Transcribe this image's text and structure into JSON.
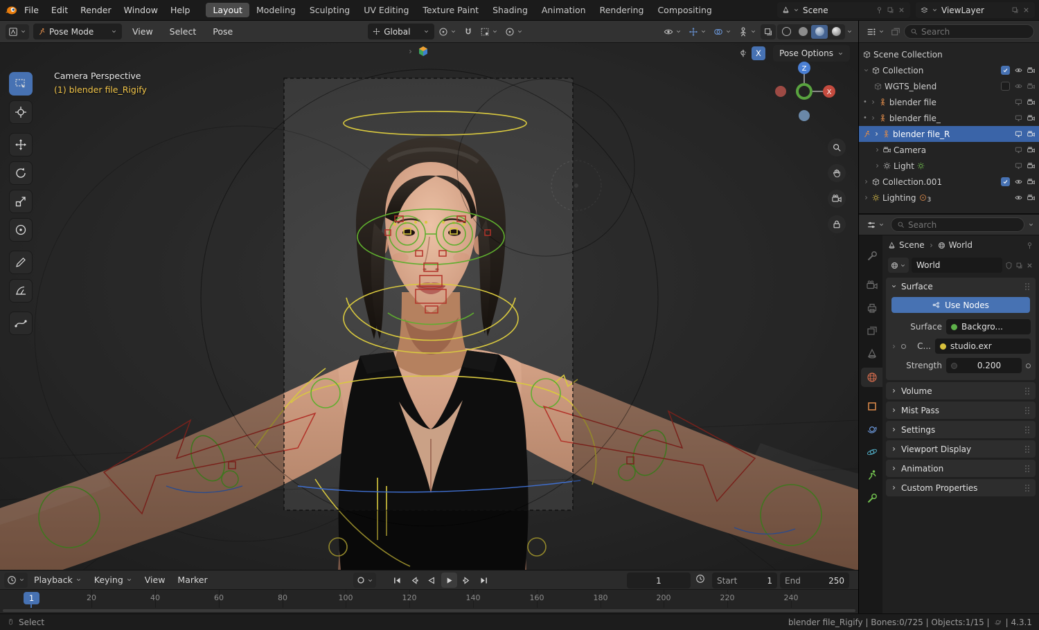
{
  "topbar": {
    "menus": [
      "File",
      "Edit",
      "Render",
      "Window",
      "Help"
    ],
    "workspaces": [
      "Layout",
      "Modeling",
      "Sculpting",
      "UV Editing",
      "Texture Paint",
      "Shading",
      "Animation",
      "Rendering",
      "Compositing"
    ],
    "scene": "Scene",
    "view_layer": "ViewLayer"
  },
  "viewport_header": {
    "mode": "Pose Mode",
    "menu_view": "View",
    "menu_select": "Select",
    "menu_pose": "Pose",
    "orientation": "Global"
  },
  "viewport": {
    "view_label": "Camera Perspective",
    "object_label": "(1) blender file_Rigify",
    "pose_options": "Pose Options",
    "mirror_x": "X",
    "gizmo": {
      "z": "Z",
      "x": "X"
    }
  },
  "outliner": {
    "search_placeholder": "Search",
    "rows": [
      {
        "label": "Scene Collection"
      },
      {
        "label": "Collection"
      },
      {
        "label": "WGTS_blend"
      },
      {
        "label": "blender file"
      },
      {
        "label": "blender file_"
      },
      {
        "label": "blender file_R"
      },
      {
        "label": "Camera"
      },
      {
        "label": "Light"
      },
      {
        "label": "Collection.001"
      },
      {
        "label": "Lighting",
        "badge": "3"
      }
    ]
  },
  "properties": {
    "search_placeholder": "Search",
    "breadcrumb_scene": "Scene",
    "breadcrumb_world": "World",
    "world_name": "World",
    "surface_panel": "Surface",
    "use_nodes": "Use Nodes",
    "surface_label": "Surface",
    "surface_value": "Backgro...",
    "color_label": "C...",
    "color_value": "studio.exr",
    "strength_label": "Strength",
    "strength_value": "0.200",
    "collapsed_panels": [
      "Volume",
      "Mist Pass",
      "Settings",
      "Viewport Display",
      "Animation",
      "Custom Properties"
    ]
  },
  "timeline": {
    "playback": "Playback",
    "keying": "Keying",
    "view": "View",
    "marker": "Marker",
    "current_frame": "1",
    "start_label": "Start",
    "start_value": "1",
    "end_label": "End",
    "end_value": "250",
    "ticks": [
      "20",
      "40",
      "60",
      "80",
      "100",
      "120",
      "140",
      "160",
      "180",
      "200",
      "220",
      "240"
    ],
    "playhead": "1"
  },
  "statusbar": {
    "select": "Select",
    "info": "blender file_Rigify | Bones:0/725 | Objects:1/15 |",
    "version": "| 4.3.1"
  }
}
